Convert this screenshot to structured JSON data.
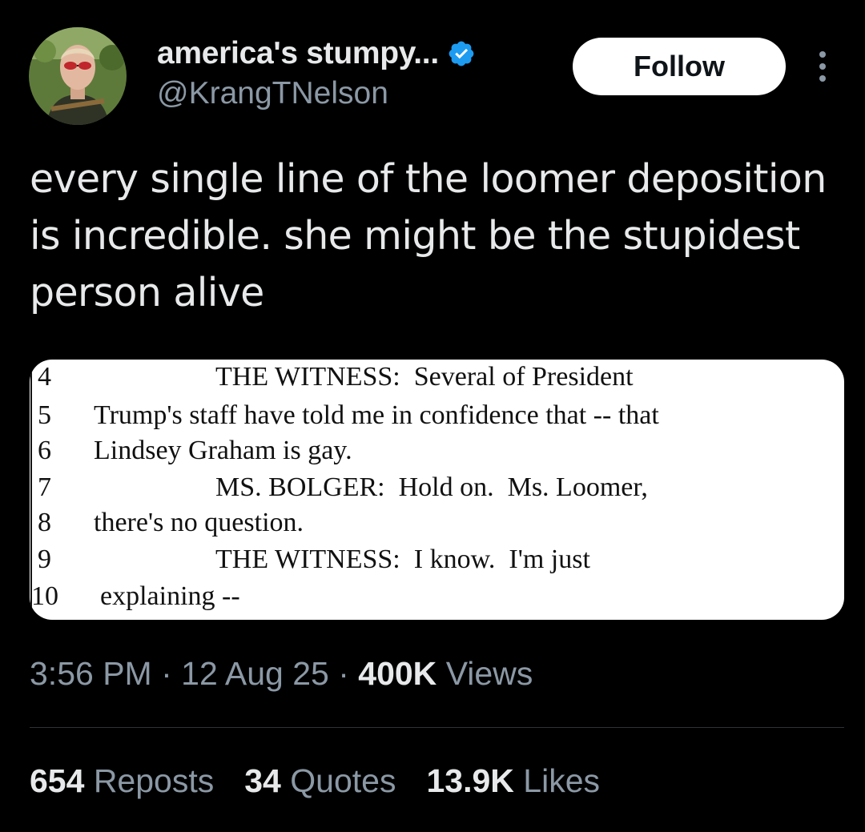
{
  "author": {
    "display_name": "america's stumpy...",
    "handle": "@KrangTNelson",
    "verified_icon": "verified-badge-icon",
    "verified_color": "#1d9bf0"
  },
  "follow_label": "Follow",
  "more_icon": "more-vertical-icon",
  "tweet_text": "every single line of the loomer deposition is incredible. she might be the stupidest person alive",
  "transcript": {
    "lines": [
      {
        "num": "4",
        "text": "THE WITNESS:  Several of President"
      },
      {
        "num": "5",
        "text": "Trump's staff have told me in confidence that -- that"
      },
      {
        "num": "6",
        "text": "Lindsey Graham is gay."
      },
      {
        "num": "7",
        "text": "MS. BOLGER:  Hold on.  Ms. Loomer,"
      },
      {
        "num": "8",
        "text": "there's no question."
      },
      {
        "num": "9",
        "text": "THE WITNESS:  I know.  I'm just"
      },
      {
        "num": "10",
        "text": "explaining --"
      }
    ]
  },
  "meta": {
    "time": "3:56 PM",
    "sep": " · ",
    "date": "12 Aug 25",
    "views_count": "400K",
    "views_label": "Views"
  },
  "stats": {
    "reposts_count": "654",
    "reposts_label": "Reposts",
    "quotes_count": "34",
    "quotes_label": "Quotes",
    "likes_count": "13.9K",
    "likes_label": "Likes"
  },
  "colors": {
    "background": "#000000",
    "text": "#e7e9ea",
    "secondary": "#8b98a5",
    "divider": "#2f3336"
  }
}
